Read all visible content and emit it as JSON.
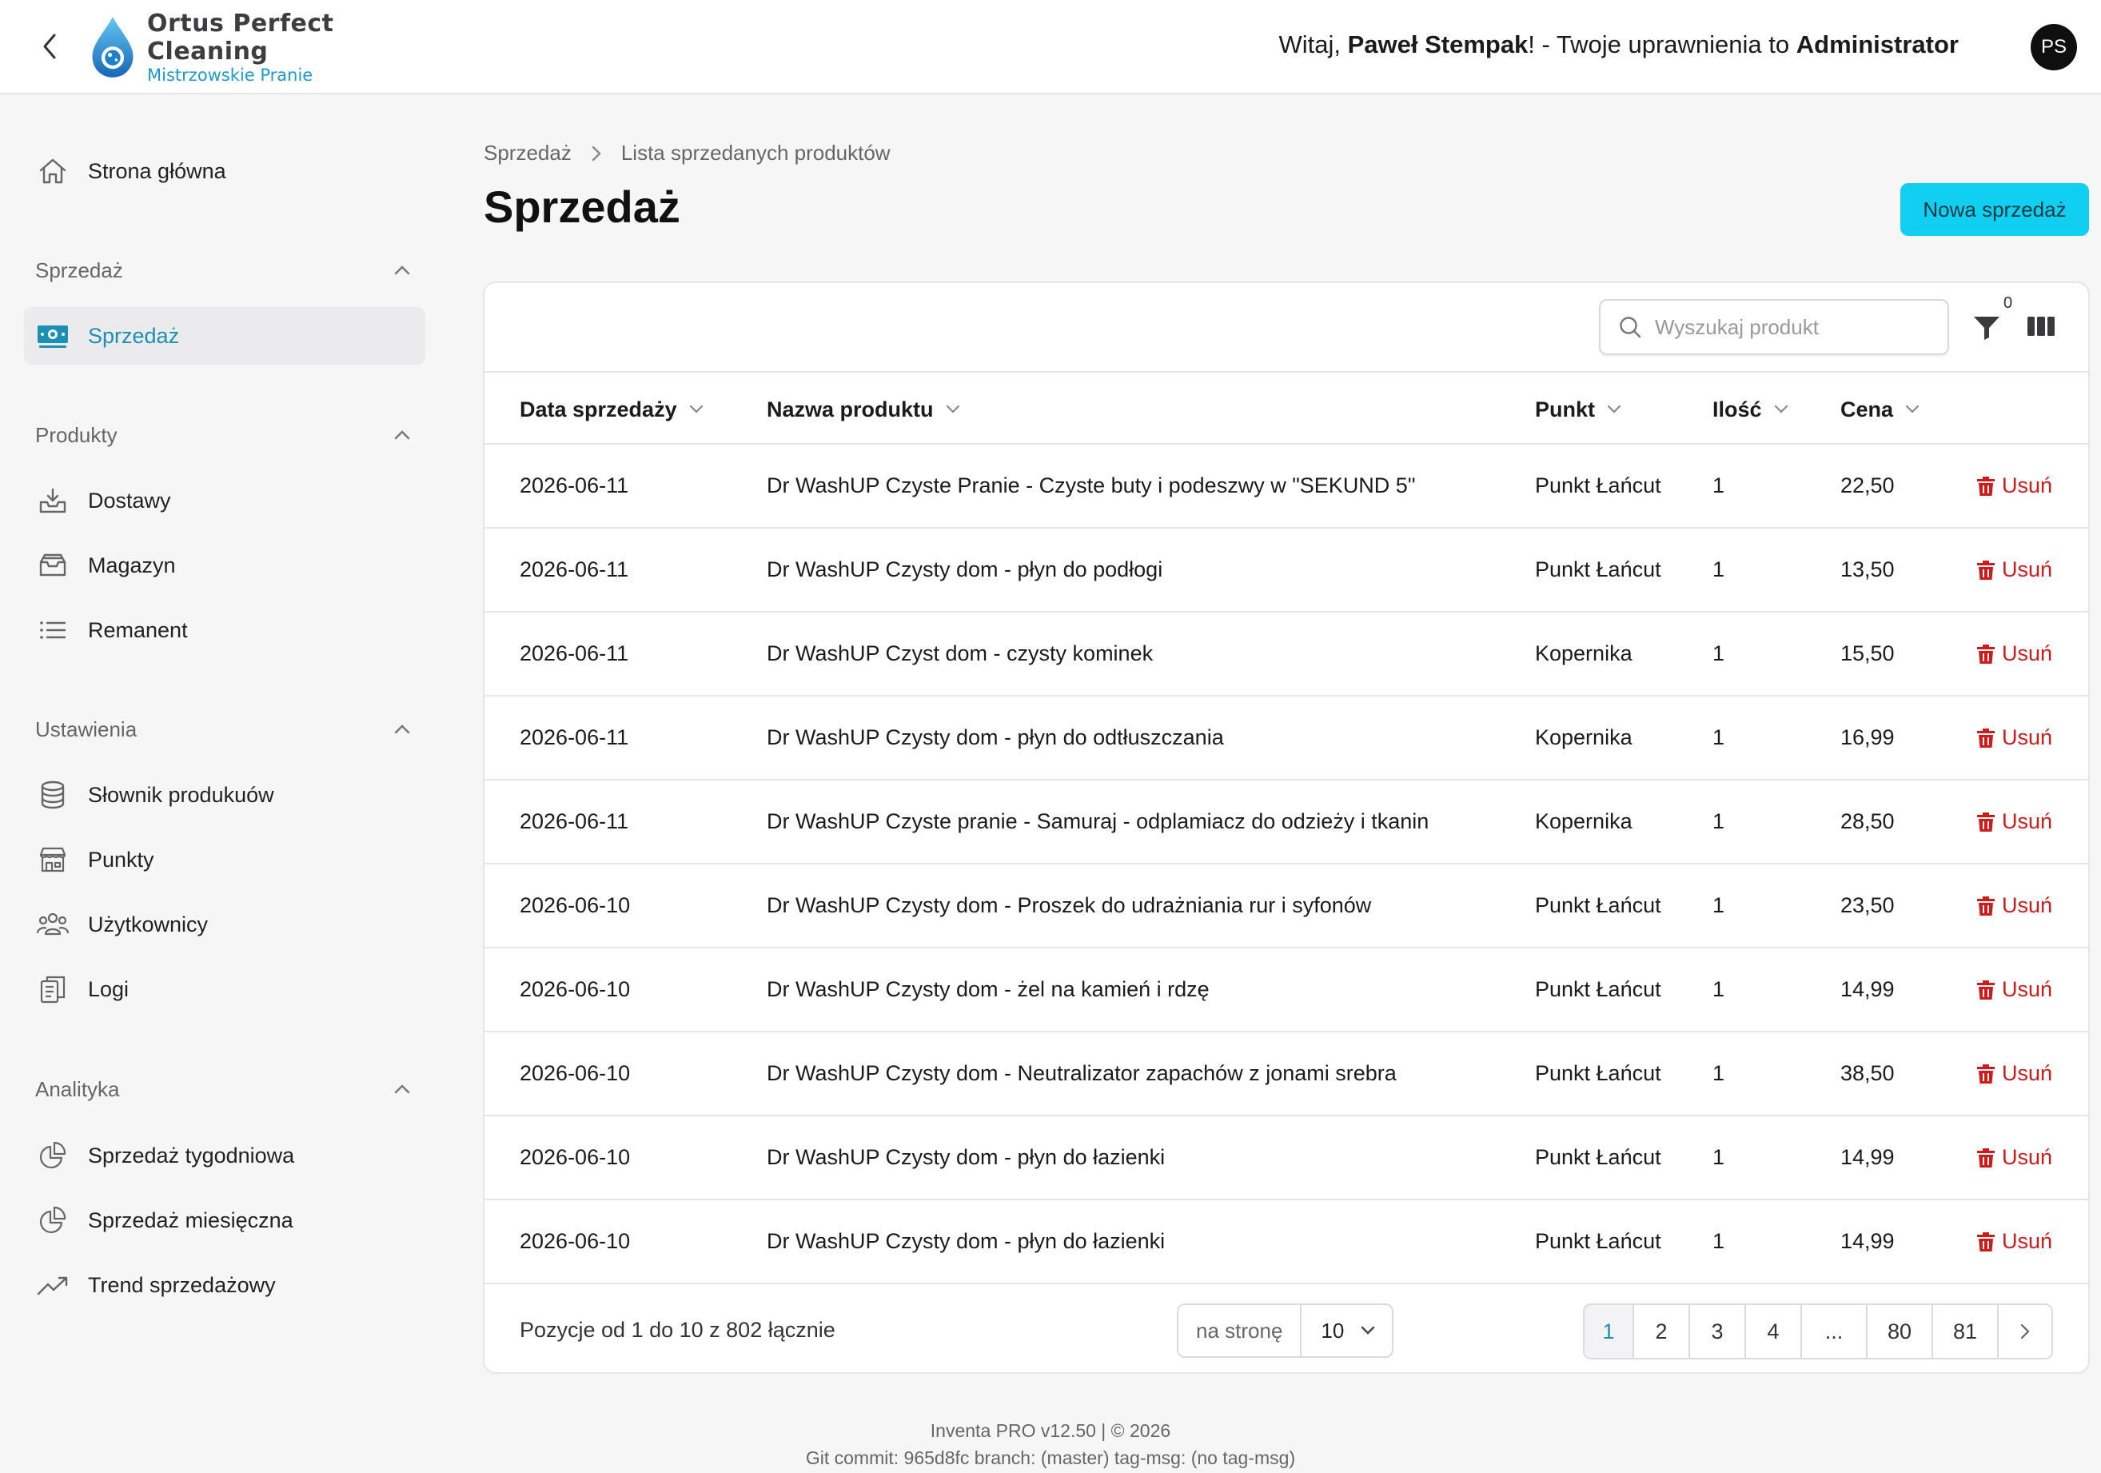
{
  "header": {
    "logo_name": "Ortus Perfect Cleaning",
    "logo_sub": "Mistrzowskie Pranie",
    "welcome_prefix": "Witaj, ",
    "user_name": "Paweł Stempak",
    "welcome_mid": "! - Twoje uprawnienia to ",
    "role": "Administrator",
    "avatar_initials": "PS"
  },
  "sidebar": {
    "home": "Strona główna",
    "sections": [
      {
        "title": "Sprzedaż",
        "items": [
          "Sprzedaż"
        ]
      },
      {
        "title": "Produkty",
        "items": [
          "Dostawy",
          "Magazyn",
          "Remanent"
        ]
      },
      {
        "title": "Ustawienia",
        "items": [
          "Słownik produkuów",
          "Punkty",
          "Użytkownicy",
          "Logi"
        ]
      },
      {
        "title": "Analityka",
        "items": [
          "Sprzedaż tygodniowa",
          "Sprzedaż miesięczna",
          "Trend sprzedażowy"
        ]
      }
    ]
  },
  "breadcrumb": {
    "parent": "Sprzedaż",
    "current": "Lista sprzedanych produktów"
  },
  "page": {
    "title": "Sprzedaż",
    "new_button": "Nowa sprzedaż"
  },
  "toolbar": {
    "search_placeholder": "Wyszukaj produkt",
    "filter_count": "0"
  },
  "table": {
    "headers": [
      "Data sprzedaży",
      "Nazwa produktu",
      "Punkt",
      "Ilość",
      "Cena"
    ],
    "delete_label": "Usuń",
    "rows": [
      [
        "2026-06-11",
        "Dr WashUP Czyste Pranie - Czyste buty i podeszwy w \"SEKUND 5\"",
        "Punkt Łańcut",
        "1",
        "22,50"
      ],
      [
        "2026-06-11",
        "Dr WashUP Czysty dom - płyn do podłogi",
        "Punkt Łańcut",
        "1",
        "13,50"
      ],
      [
        "2026-06-11",
        "Dr WashUP Czyst dom - czysty kominek",
        "Kopernika",
        "1",
        "15,50"
      ],
      [
        "2026-06-11",
        "Dr WashUP Czysty dom - płyn do odtłuszczania",
        "Kopernika",
        "1",
        "16,99"
      ],
      [
        "2026-06-11",
        "Dr WashUP Czyste pranie - Samuraj - odplamiacz do odzieży i tkanin",
        "Kopernika",
        "1",
        "28,50"
      ],
      [
        "2026-06-10",
        "Dr WashUP Czysty dom - Proszek do udrażniania rur i syfonów",
        "Punkt Łańcut",
        "1",
        "23,50"
      ],
      [
        "2026-06-10",
        "Dr WashUP Czysty dom - żel na kamień i rdzę",
        "Punkt Łańcut",
        "1",
        "14,99"
      ],
      [
        "2026-06-10",
        "Dr WashUP Czysty dom - Neutralizator zapachów z jonami srebra",
        "Punkt Łańcut",
        "1",
        "38,50"
      ],
      [
        "2026-06-10",
        "Dr WashUP Czysty dom - płyn do łazienki",
        "Punkt Łańcut",
        "1",
        "14,99"
      ],
      [
        "2026-06-10",
        "Dr WashUP Czysty dom - płyn do łazienki",
        "Punkt Łańcut",
        "1",
        "14,99"
      ]
    ]
  },
  "pagination": {
    "summary": "Pozycje od 1 do 10 z 802 łącznie",
    "per_page_label": "na stronę",
    "per_page_value": "10",
    "pages": [
      "1",
      "2",
      "3",
      "4",
      "...",
      "80",
      "81"
    ],
    "active_page": "1"
  },
  "footer": {
    "version": "Inventa PRO v12.50 | © 2026",
    "git": "Git commit: 965d8fc branch: (master) tag-msg: (no tag-msg)"
  },
  "colors": {
    "accent": "#11cff0",
    "active_text": "#1b8fb4",
    "danger": "#d11a1a"
  }
}
